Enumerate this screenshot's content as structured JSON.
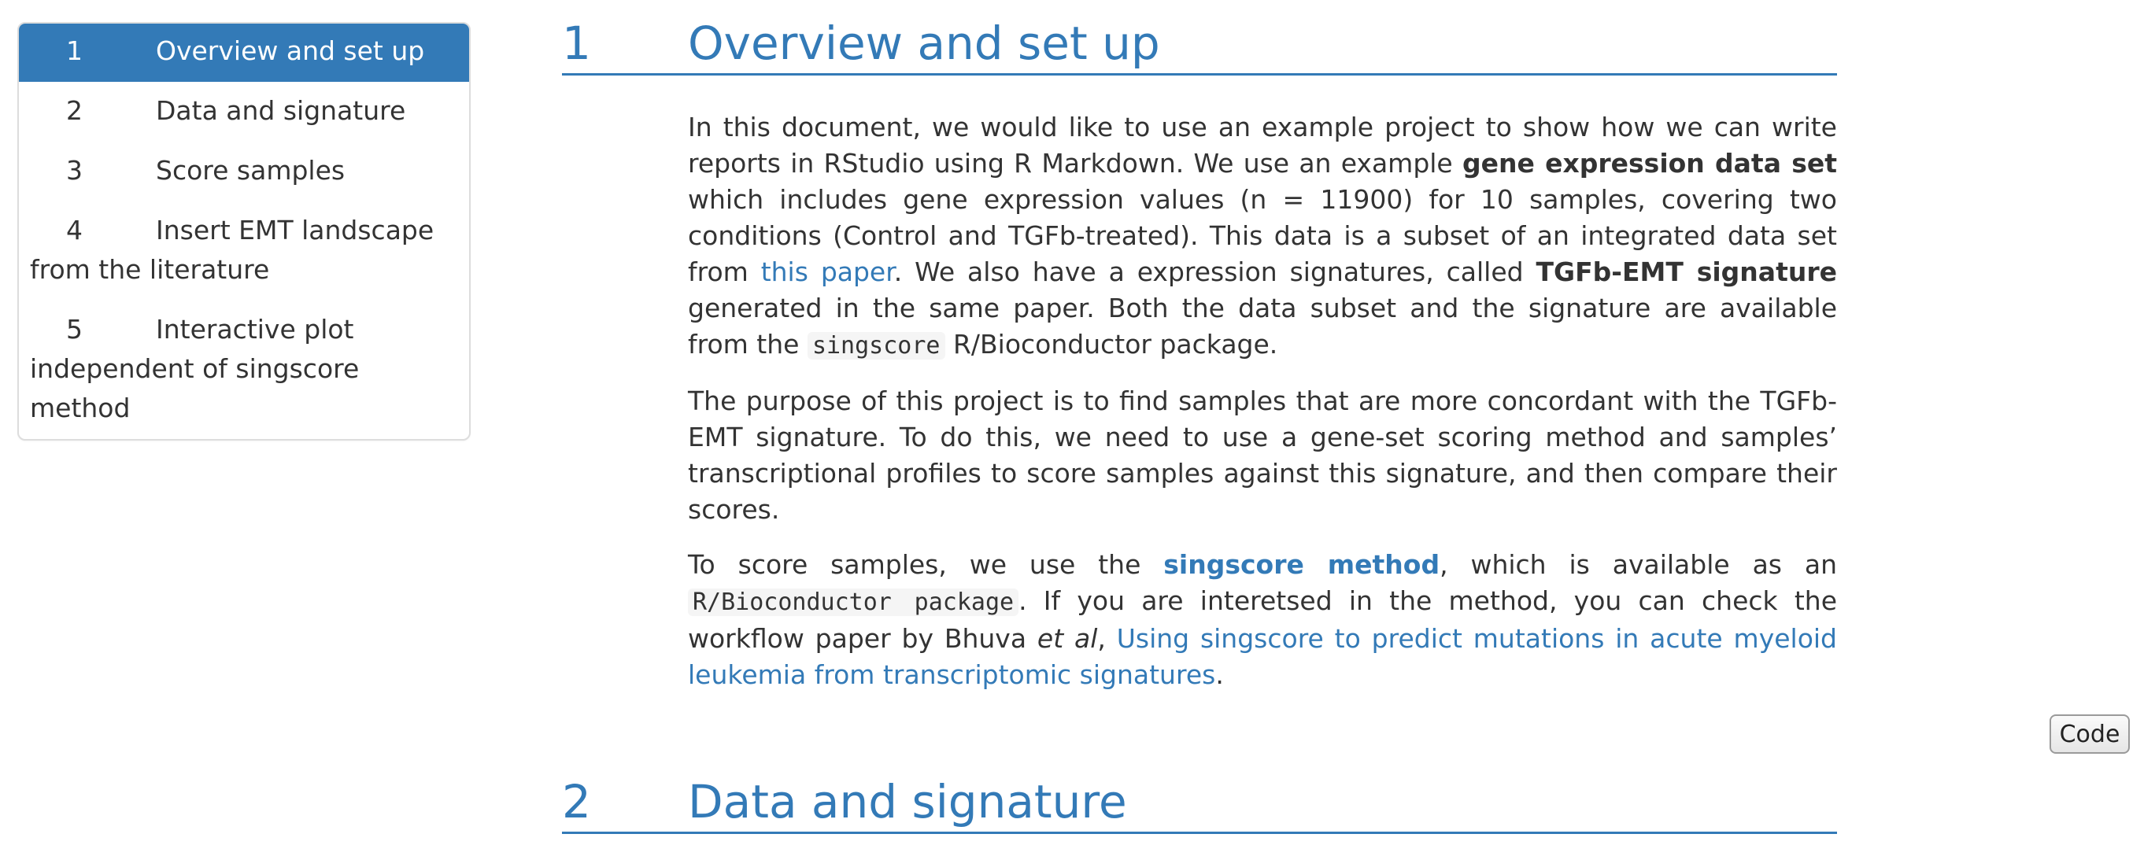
{
  "toc": {
    "items": [
      {
        "num": "1",
        "label": "Overview and set up"
      },
      {
        "num": "2",
        "label": "Data and signature"
      },
      {
        "num": "3",
        "label": "Score samples"
      },
      {
        "num": "4",
        "label": "Insert EMT landscape from the literature"
      },
      {
        "num": "5",
        "label": "Interactive plot independent of singscore method"
      }
    ]
  },
  "sections": [
    {
      "num": "1",
      "title": "Overview and set up"
    },
    {
      "num": "2",
      "title": "Data and signature"
    }
  ],
  "p1": {
    "t1": "In this document, we would like to use an example project to show how we can write reports in RStudio using R Markdown. We use an example ",
    "b1": "gene expression data set",
    "t2": " which includes gene expression values (n = 11900) for 10 samples, covering two conditions (Control and TGFb-treated). This data is a subset of an integrated data set from ",
    "link1": "this paper",
    "t3": ". We also have a expression signatures, called ",
    "b2": "TGFb-EMT signature",
    "t4": " generated in the same paper. Both the data subset and the signature are available from the ",
    "code1": "singscore",
    "t5": " R/Bioconductor package."
  },
  "p2": {
    "text": "The purpose of this project is to find samples that are more concordant with the TGFb-EMT signature. To do this, we need to use a gene-set scoring method and samples’ transcriptional profiles to score samples against this signature, and then compare their scores."
  },
  "p3": {
    "t1": "To score samples, we use the ",
    "link1": "singscore method",
    "t2": ", which is available as an ",
    "code1": "R/Bioconductor package",
    "t3": ". If you are interetsed in the method, you can check the workflow paper by Bhuva ",
    "i1": "et al",
    "t4": ", ",
    "link2": "Using singscore to predict mutations in acute myeloid leukemia from transcriptomic signatures",
    "t5": "."
  },
  "code_button": {
    "label": "Code"
  },
  "colors": {
    "accent": "#337ab7",
    "text": "#333333",
    "code_bg": "#f5f5f5"
  }
}
